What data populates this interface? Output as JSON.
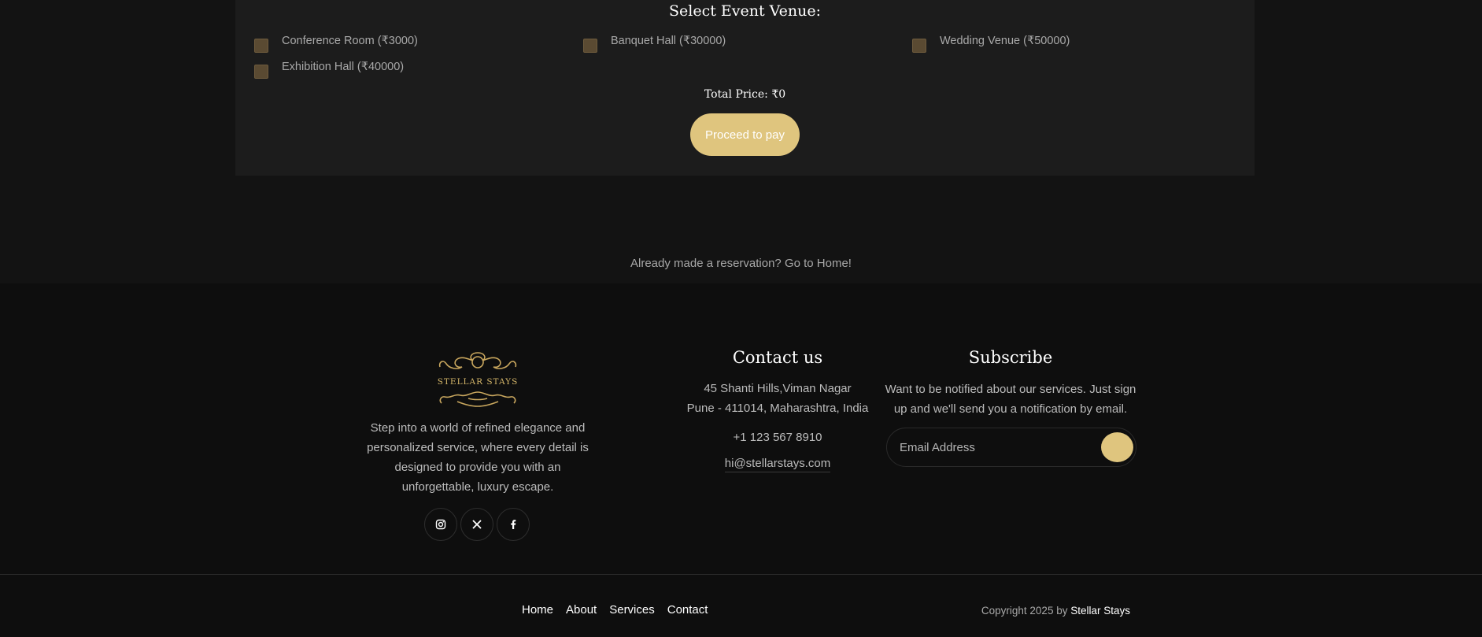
{
  "venue": {
    "title": "Select Event Venue:",
    "options": [
      {
        "label": "Conference Room (₹3000)"
      },
      {
        "label": "Banquet Hall (₹30000)"
      },
      {
        "label": "Wedding Venue (₹50000)"
      },
      {
        "label": "Exhibition Hall (₹40000)"
      }
    ],
    "total_price": "Total Price: ₹0",
    "pay_label": "Proceed to pay"
  },
  "reservation_note": "Already made a reservation? Go to Home!",
  "footer": {
    "logo_text": "STELLAR STAYS",
    "about": "Step into a world of refined elegance and personalized service, where every detail is designed to provide you with an unforgettable, luxury escape.",
    "social": [
      {
        "icon": "instagram-icon"
      },
      {
        "icon": "x-icon"
      },
      {
        "icon": "facebook-icon"
      }
    ],
    "contact": {
      "title": "Contact us",
      "address_line1": "45 Shanti Hills,Viman Nagar",
      "address_line2": "Pune - 411014, Maharashtra, India",
      "phone": "+1 123 567 8910",
      "email": "hi@stellarstays.com"
    },
    "subscribe": {
      "title": "Subscribe",
      "text": "Want to be notified about our services. Just sign up and we'll send you a notification by email.",
      "placeholder": "Email Address"
    },
    "nav": {
      "home": "Home",
      "about": "About",
      "services": "Services",
      "contact": "Contact"
    },
    "copyright_prefix": "Copyright 2025 by ",
    "copyright_brand": "Stellar Stays"
  },
  "colors": {
    "accent": "#dfc57e",
    "checkbox": "#5a4a32",
    "background": "#121212",
    "card": "#1c1c1c"
  }
}
